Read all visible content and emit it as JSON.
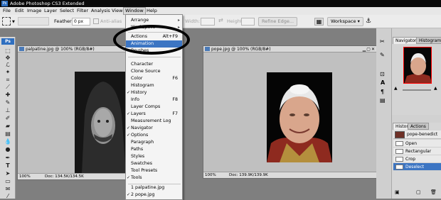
{
  "app": {
    "title": "Adobe Photoshop CS3 Extended",
    "logo": "Ps"
  },
  "menubar": [
    "File",
    "Edit",
    "Image",
    "Layer",
    "Select",
    "Filter",
    "Analysis",
    "View",
    "Window",
    "Help"
  ],
  "options": {
    "feather_label": "Feather:",
    "feather_value": "0 px",
    "antialias": "Anti-alias",
    "width_label": "Width:",
    "height_label": "Height:",
    "refine_edge": "Refine Edge...",
    "workspace": "Workspace"
  },
  "documents": {
    "left": {
      "title": "palpatine.jpg @ 100% (RGB/8#)",
      "zoom": "100%",
      "doc": "Doc: 134.5K/134.5K"
    },
    "right": {
      "title": "pope.jpg @ 100% (RGB/8#)",
      "zoom": "100%",
      "doc": "Doc: 139.9K/139.9K"
    }
  },
  "window_menu": {
    "items": [
      {
        "label": "Arrange",
        "submenu": true
      },
      {
        "label": "Workspace",
        "submenu": true
      },
      {
        "label": "Actions",
        "shortcut": "Alt+F9"
      },
      {
        "label": "Animation",
        "selected": true
      },
      {
        "label": "Brushes"
      },
      {
        "label": "Character"
      },
      {
        "label": "Clone Source"
      },
      {
        "label": "Color",
        "shortcut": "F6"
      },
      {
        "label": "Histogram"
      },
      {
        "label": "History",
        "checked": true
      },
      {
        "label": "Info",
        "shortcut": "F8"
      },
      {
        "label": "Layer Comps"
      },
      {
        "label": "Layers",
        "shortcut": "F7",
        "checked": true
      },
      {
        "label": "Measurement Log"
      },
      {
        "label": "Navigator",
        "checked": true
      },
      {
        "label": "Options",
        "checked": true
      },
      {
        "label": "Paragraph"
      },
      {
        "label": "Paths"
      },
      {
        "label": "Styles"
      },
      {
        "label": "Swatches"
      },
      {
        "label": "Tool Presets"
      },
      {
        "label": "Tools",
        "checked": true
      },
      {
        "label": "1 palpatine.jpg"
      },
      {
        "label": "2 pope.jpg",
        "checked": true
      }
    ]
  },
  "panels": {
    "navigator_tabs": [
      "Navigator",
      "Histogram"
    ],
    "history_tabs": [
      "History",
      "Actions"
    ],
    "history_snapshot": "pope-benedict",
    "history_rows": [
      "Open",
      "Rectangular Mar...",
      "Crop",
      "Deselect"
    ]
  }
}
